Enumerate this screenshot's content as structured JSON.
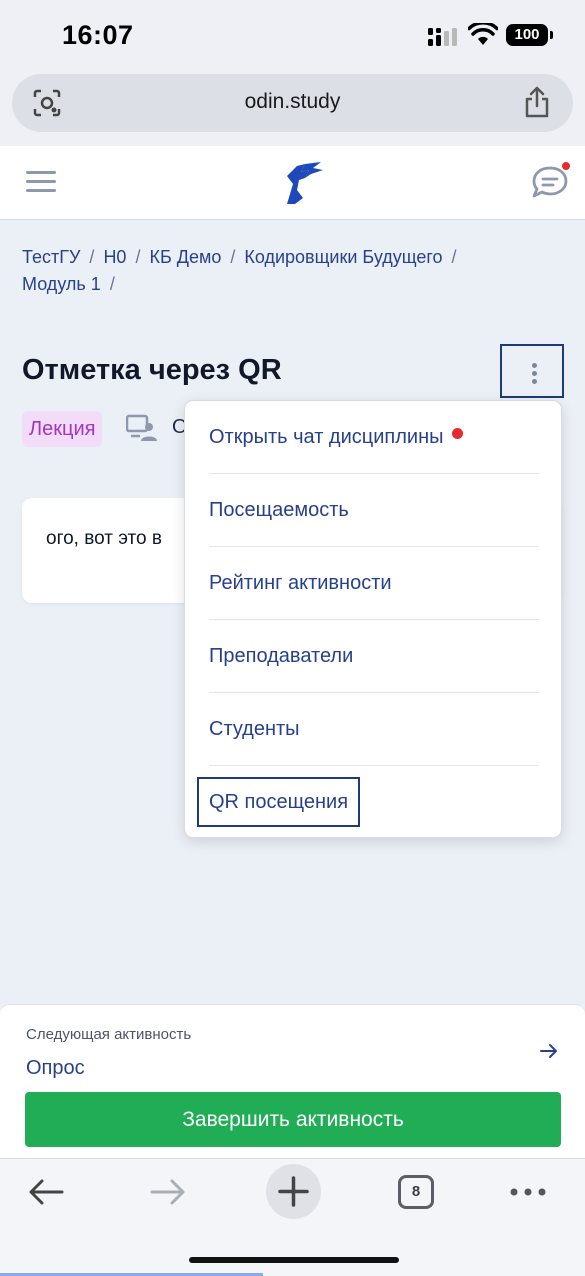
{
  "status_bar": {
    "time": "16:07",
    "battery": "100"
  },
  "browser": {
    "url": "odin.study",
    "tab_count": "8"
  },
  "header": {
    "menu_icon": "hamburger-icon",
    "logo": "odin-logo",
    "chat_icon": "chat-icon",
    "has_notification": true
  },
  "breadcrumb": {
    "items": [
      "ТестГУ",
      "Н0",
      "КБ Демо",
      "Кодировщики Будущего",
      "Модуль 1"
    ]
  },
  "page": {
    "title": "Отметка через QR",
    "type_badge": "Лекция",
    "presence_text": "О",
    "content_text": "ого, вот это в"
  },
  "dropdown": {
    "items": [
      {
        "label": "Открыть чат дисциплины",
        "has_dot": true
      },
      {
        "label": "Посещаемость"
      },
      {
        "label": "Рейтинг активности"
      },
      {
        "label": "Преподаватели"
      },
      {
        "label": "Студенты"
      },
      {
        "label": "QR посещения",
        "focused": true
      }
    ]
  },
  "next_activity": {
    "caption": "Следующая активность",
    "title": "Опрос"
  },
  "actions": {
    "finish_label": "Завершить активность"
  },
  "colors": {
    "accent": "#27408b",
    "success": "#20ad55",
    "badge_bg": "#f2dcf7",
    "badge_text": "#a235c5",
    "notification": "#e52b2b"
  }
}
